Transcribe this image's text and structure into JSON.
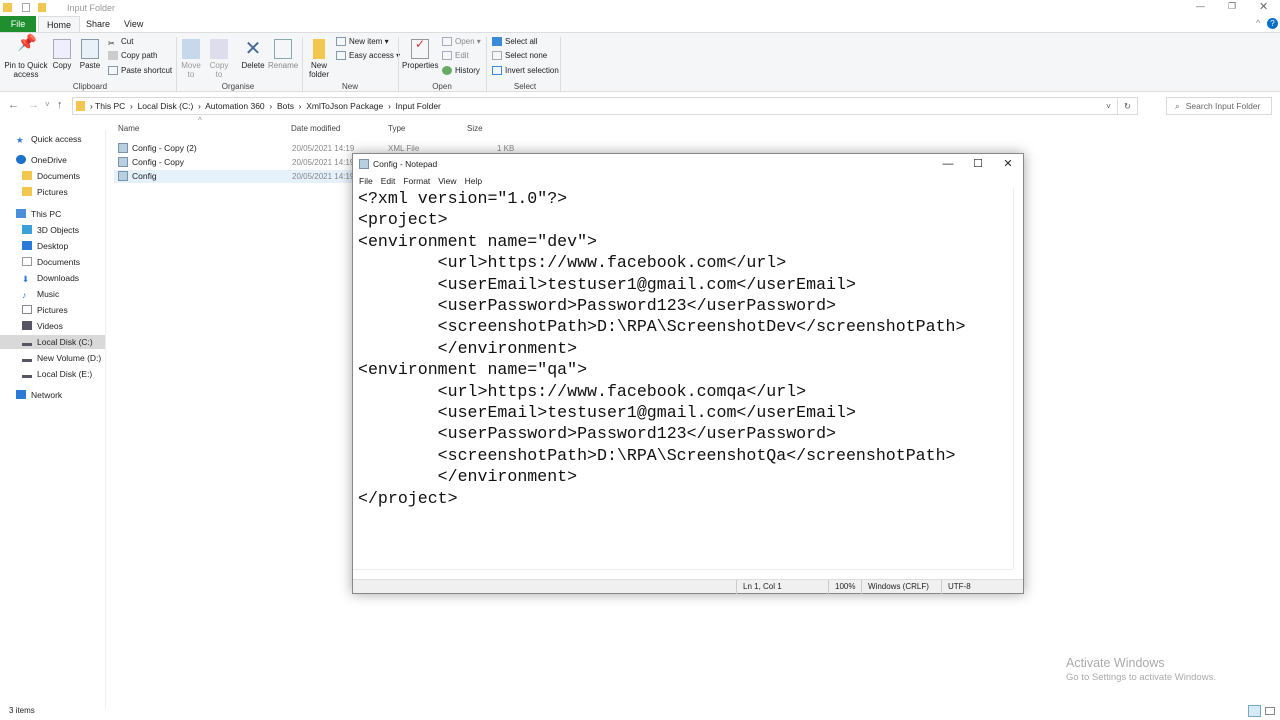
{
  "explorer": {
    "title": "Input Folder",
    "tabs": [
      "File",
      "Home",
      "Share",
      "View"
    ],
    "ribbon": {
      "clipboard": {
        "pin": "Pin to Quick access",
        "copy": "Copy",
        "paste": "Paste",
        "cut": "Cut",
        "copy_path": "Copy path",
        "paste_shortcut": "Paste shortcut",
        "group": "Clipboard"
      },
      "organise": {
        "move_to": "Move to",
        "copy_to": "Copy to",
        "delete": "Delete",
        "rename": "Rename",
        "group": "Organise"
      },
      "new": {
        "new_folder": "New folder",
        "new_item": "New item",
        "easy_access": "Easy access",
        "group": "New"
      },
      "open": {
        "properties": "Properties",
        "open": "Open",
        "edit": "Edit",
        "history": "History",
        "group": "Open"
      },
      "select": {
        "select_all": "Select all",
        "select_none": "Select none",
        "invert": "Invert selection",
        "group": "Select"
      }
    },
    "breadcrumb": [
      "This PC",
      "Local Disk (C:)",
      "Automation 360",
      "Bots",
      "XmlToJson Package",
      "Input Folder"
    ],
    "search_placeholder": "Search Input Folder",
    "nav": [
      "Quick access",
      "OneDrive",
      "Documents",
      "Pictures",
      "This PC",
      "3D Objects",
      "Desktop",
      "Documents",
      "Downloads",
      "Music",
      "Pictures",
      "Videos",
      "Local Disk (C:)",
      "New Volume (D:)",
      "Local Disk (E:)",
      "Network"
    ],
    "columns": [
      "Name",
      "Date modified",
      "Type",
      "Size"
    ],
    "files": [
      {
        "name": "Config - Copy (2)",
        "date": "20/05/2021 14:19",
        "type": "XML File",
        "size": "1 KB"
      },
      {
        "name": "Config - Copy",
        "date": "20/05/2021 14:19"
      },
      {
        "name": "Config",
        "date": "20/05/2021 14:19"
      }
    ],
    "status": "3 items"
  },
  "notepad": {
    "title": "Config - Notepad",
    "menu": [
      "File",
      "Edit",
      "Format",
      "View",
      "Help"
    ],
    "content": "<?xml version=\"1.0\"?>\n<project>\n<environment name=\"dev\">\n\t<url>https://www.facebook.com</url>\n\t<userEmail>testuser1@gmail.com</userEmail>\n\t<userPassword>Password123</userPassword>\n\t<screenshotPath>D:\\RPA\\ScreenshotDev</screenshotPath>\n\t</environment>\n<environment name=\"qa\">\n\t<url>https://www.facebook.comqa</url>\n\t<userEmail>testuser1@gmail.com</userEmail>\n\t<userPassword>Password123</userPassword>\n\t<screenshotPath>D:\\RPA\\ScreenshotQa</screenshotPath>\n\t</environment>\n</project>",
    "status": {
      "position": "Ln 1, Col 1",
      "zoom": "100%",
      "line_ending": "Windows (CRLF)",
      "encoding": "UTF-8"
    }
  },
  "watermark": {
    "title": "Activate Windows",
    "subtitle": "Go to Settings to activate Windows."
  }
}
